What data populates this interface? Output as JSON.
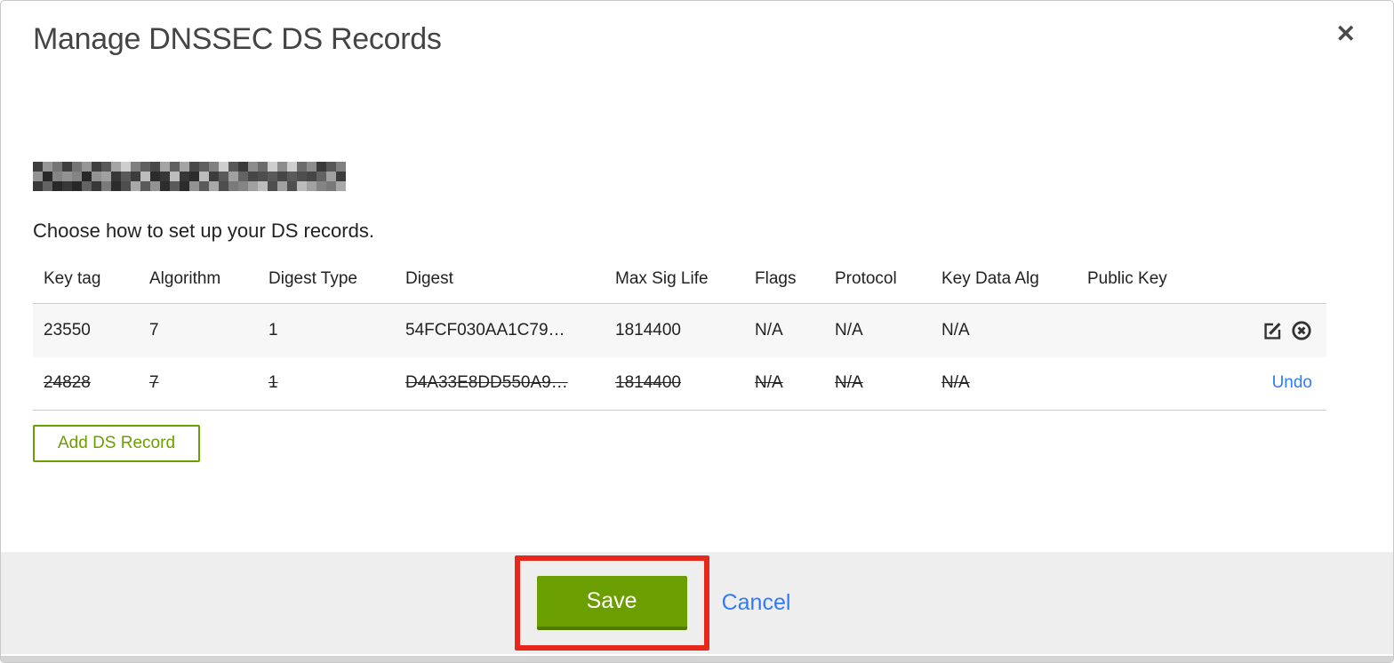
{
  "modal": {
    "title": "Manage DNSSEC DS Records",
    "close_glyph": "✕",
    "instruction": "Choose how to set up your DS records.",
    "add_button_label": "Add DS Record"
  },
  "table": {
    "columns": [
      "Key tag",
      "Algorithm",
      "Digest Type",
      "Digest",
      "Max Sig Life",
      "Flags",
      "Protocol",
      "Key Data Alg",
      "Public Key"
    ],
    "rows": [
      {
        "key_tag": "23550",
        "algorithm": "7",
        "digest_type": "1",
        "digest": "54FCF030AA1C79…",
        "max_sig_life": "1814400",
        "flags": "N/A",
        "protocol": "N/A",
        "key_data_alg": "N/A",
        "public_key": "",
        "state": "active",
        "actions": [
          "edit",
          "delete"
        ]
      },
      {
        "key_tag": "24828",
        "algorithm": "7",
        "digest_type": "1",
        "digest": "D4A33E8DD550A9…",
        "max_sig_life": "1814400",
        "flags": "N/A",
        "protocol": "N/A",
        "key_data_alg": "N/A",
        "public_key": "",
        "state": "deleted",
        "undo_label": "Undo"
      }
    ]
  },
  "footer": {
    "save_label": "Save",
    "cancel_label": "Cancel"
  },
  "colors": {
    "accent_green": "#6b9e00",
    "accent_green_dark": "#507a00",
    "link_blue": "#2f7cf6",
    "annotation_red": "#e8271c"
  }
}
